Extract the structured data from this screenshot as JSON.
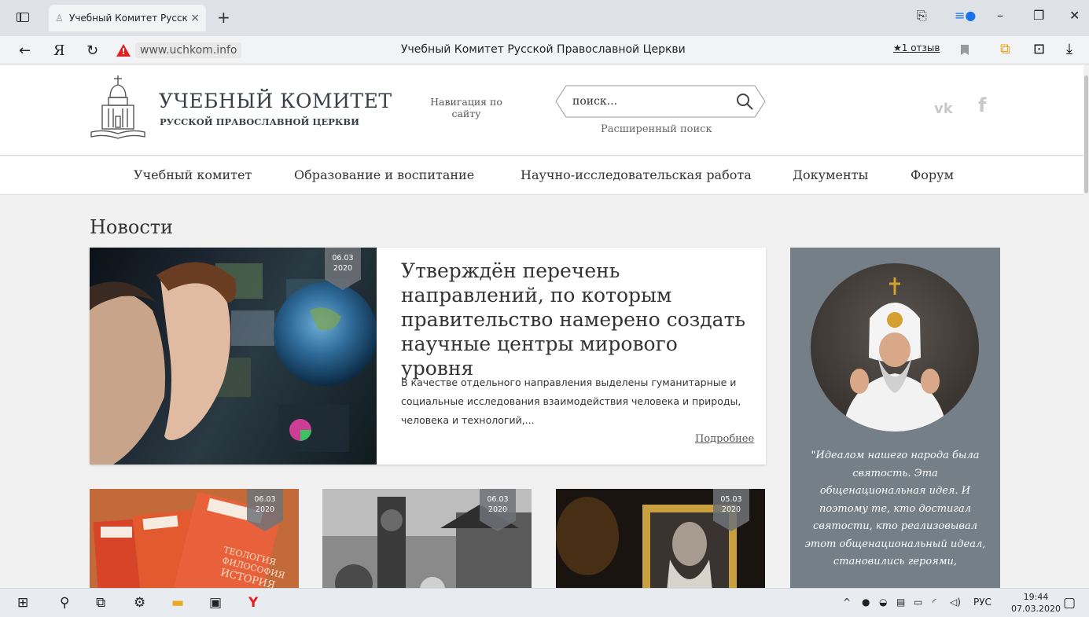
{
  "browser": {
    "tab_title": "Учебный Комитет Русск",
    "url": "www.uchkom.info",
    "page_title": "Учебный Комитет Русской Православной Церкви",
    "reviews": "★1 отзыв"
  },
  "header": {
    "logo_title": "УЧЕБНЫЙ КОМИТЕТ",
    "logo_subtitle": "РУССКОЙ ПРАВОСЛАВНОЙ ЦЕРКВИ",
    "site_nav": "Навигация по сайту",
    "search_placeholder": "поиск...",
    "advanced_search": "Расширенный поиск",
    "social": {
      "vk": "vk",
      "fb": "f"
    }
  },
  "menu": [
    "Учебный комитет",
    "Образование и воспитание",
    "Научно-исследовательская работа",
    "Документы",
    "Форум"
  ],
  "news": {
    "section_title": "Новости",
    "featured": {
      "date_day": "06.03",
      "date_year": "2020",
      "title": "Утверждён перечень направлений, по которым правительство намерено создать научные центры мирового уровня",
      "excerpt": "В качестве отдельного направления выделены гуманитарные и социальные исследования взаимодействия человека и природы, человека и технологий,...",
      "more": "Подробнее"
    },
    "cards": [
      {
        "date_day": "06.03",
        "date_year": "2020"
      },
      {
        "date_day": "06.03",
        "date_year": "2020"
      },
      {
        "date_day": "05.03",
        "date_year": "2020"
      }
    ]
  },
  "quote": {
    "text": "\"Идеалом нашего народа была святость. Эта общенациональная идея. И поэтому те, кто достигал святости, кто реализовывал этот общенациональный идеал, становились героями,"
  },
  "taskbar": {
    "lang": "РУС",
    "time": "19:44",
    "date": "07.03.2020"
  }
}
